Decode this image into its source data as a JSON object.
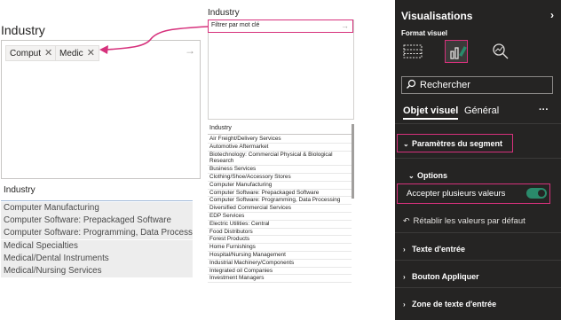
{
  "left_slicer": {
    "title": "Industry",
    "tags": [
      {
        "label": "Comput",
        "remove": "✕"
      },
      {
        "label": "Medic",
        "remove": "✕"
      }
    ],
    "submit_arrow": "→",
    "list_title": "Industry",
    "items": [
      "Computer Manufacturing",
      "Computer Software: Prepackaged Software",
      "Computer Software: Programming, Data Processing",
      "Medical Specialties",
      "Medical/Dental Instruments",
      "Medical/Nursing Services"
    ]
  },
  "middle_slicer": {
    "title": "Industry",
    "filter_placeholder": "Filtrer par mot clé",
    "filter_arrow": "→",
    "list_title": "Industry",
    "items": [
      "Air Freight/Delivery Services",
      "Automotive Aftermarket",
      "Biotechnology: Commercial Physical & Biological Research",
      "Business Services",
      "Clothing/Shoe/Accessory Stores",
      "Computer Manufacturing",
      "Computer Software: Prepackaged Software",
      "Computer Software: Programming, Data Processing",
      "Diversified Commercial Services",
      "EDP Services",
      "Electric Utilities: Central",
      "Food Distributors",
      "Forest Products",
      "Home Furnishings",
      "Hospital/Nursing Management",
      "Industrial Machinery/Components",
      "Integrated oil Companies",
      "Investment Managers"
    ]
  },
  "pane": {
    "title": "Visualisations",
    "collapse_icon": "chevron-right-icon",
    "subtitle": "Format visuel",
    "icons": [
      "build-visual-icon",
      "format-visual-icon",
      "analytics-icon"
    ],
    "search_placeholder": "Rechercher",
    "tabs": {
      "active": "Objet visuel",
      "other": "Général",
      "more": "···"
    },
    "sections": {
      "segment_settings": "Paramètres du segment",
      "options": "Options",
      "multi_select": "Accepter plusieurs valeurs",
      "multi_select_on": true,
      "reset": "Rétablir les valeurs par défaut",
      "input_text": "Texte d'entrée",
      "apply_button": "Bouton Appliquer",
      "input_text_zone": "Zone de texte d'entrée"
    }
  },
  "colors": {
    "highlight": "#d6317c",
    "pane_bg": "#252423",
    "toggle_on": "#2a8a6b"
  }
}
